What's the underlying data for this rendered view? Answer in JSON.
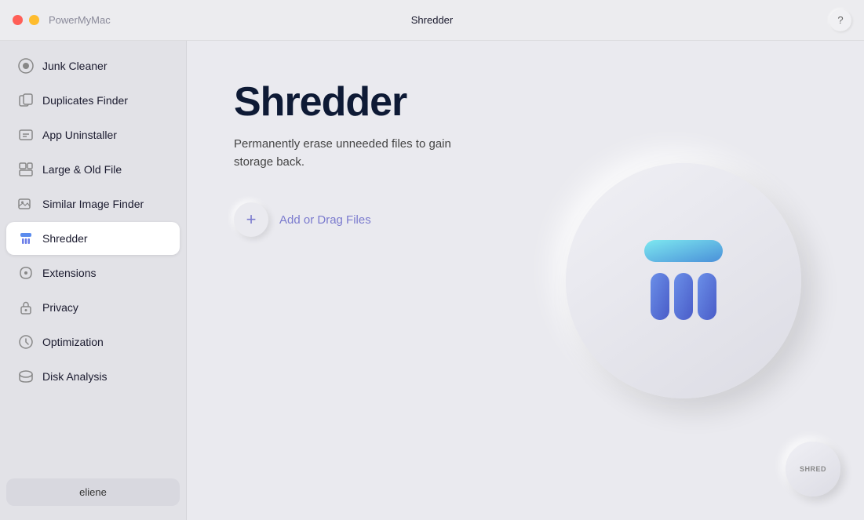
{
  "titlebar": {
    "app_name": "PowerMyMac",
    "page_name": "Shredder",
    "help_label": "?"
  },
  "sidebar": {
    "items": [
      {
        "id": "junk-cleaner",
        "label": "Junk Cleaner",
        "icon": "junk-icon"
      },
      {
        "id": "duplicates-finder",
        "label": "Duplicates Finder",
        "icon": "duplicates-icon"
      },
      {
        "id": "app-uninstaller",
        "label": "App Uninstaller",
        "icon": "uninstaller-icon"
      },
      {
        "id": "large-old-file",
        "label": "Large & Old File",
        "icon": "large-file-icon"
      },
      {
        "id": "similar-image-finder",
        "label": "Similar Image Finder",
        "icon": "image-icon"
      },
      {
        "id": "shredder",
        "label": "Shredder",
        "icon": "shredder-icon",
        "active": true
      },
      {
        "id": "extensions",
        "label": "Extensions",
        "icon": "extensions-icon"
      },
      {
        "id": "privacy",
        "label": "Privacy",
        "icon": "privacy-icon"
      },
      {
        "id": "optimization",
        "label": "Optimization",
        "icon": "optimization-icon"
      },
      {
        "id": "disk-analysis",
        "label": "Disk Analysis",
        "icon": "disk-icon"
      }
    ],
    "user_label": "eliene"
  },
  "content": {
    "title": "Shredder",
    "description": "Permanently erase unneeded files to gain storage back.",
    "add_files_label": "Add or Drag Files",
    "shred_button_label": "SHRED"
  }
}
